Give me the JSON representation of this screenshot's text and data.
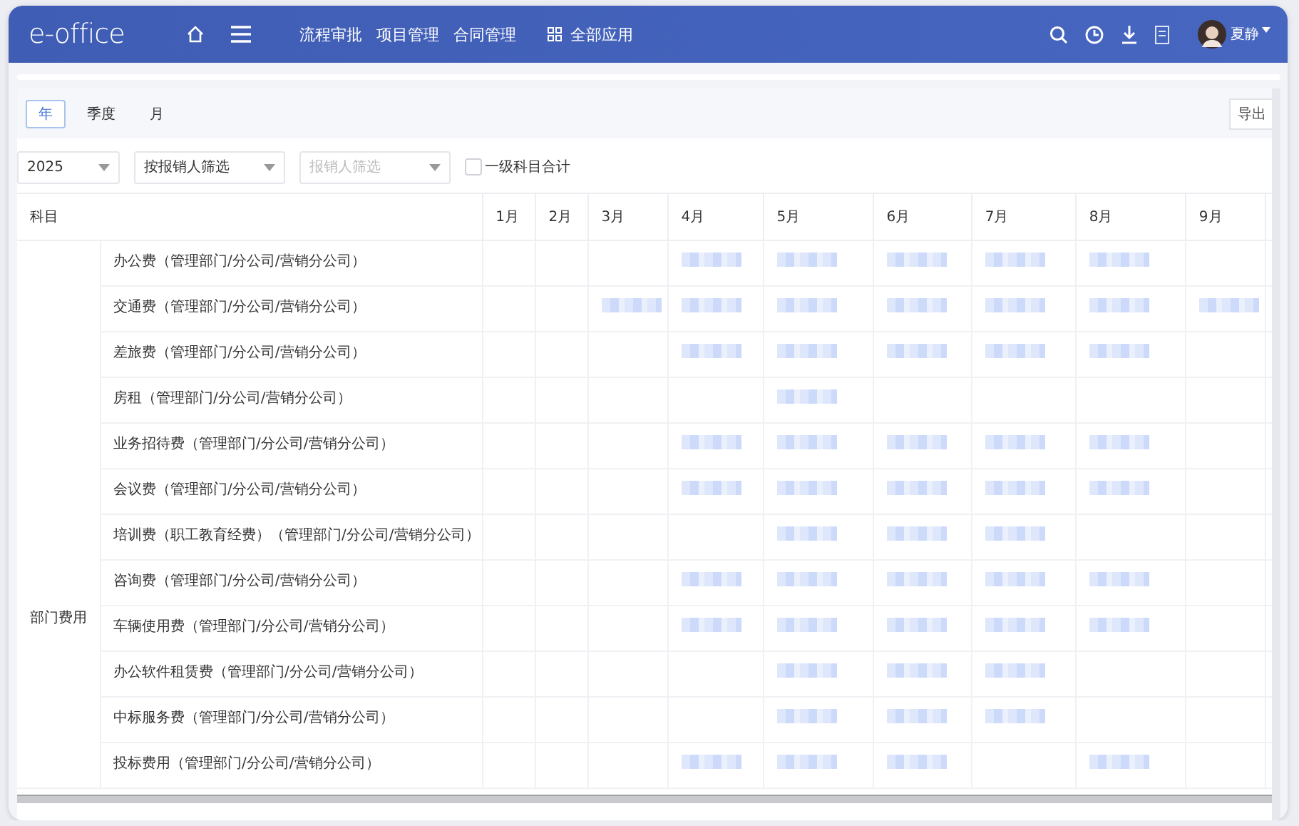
{
  "header": {
    "logo": "e-office",
    "nav": [
      "流程审批",
      "项目管理",
      "合同管理"
    ],
    "all_apps": "全部应用",
    "user": {
      "name": "夏静"
    }
  },
  "period_tabs": [
    {
      "label": "年",
      "selected": true
    },
    {
      "label": "季度",
      "selected": false
    },
    {
      "label": "月",
      "selected": false
    }
  ],
  "export_button": "导出",
  "filters": {
    "year": "2025",
    "filter_mode": "按报销人筛选",
    "reporter": {
      "placeholder": "报销人筛选"
    },
    "level_total": {
      "label": "一级科目合计",
      "checked": false
    }
  },
  "table": {
    "columns": [
      "科目",
      "1月",
      "2月",
      "3月",
      "4月",
      "5月",
      "6月",
      "7月",
      "8月",
      "9月"
    ],
    "groups": [
      {
        "name": "部门费用",
        "rows": [
          {
            "name": "办公费（管理部门/分公司/营销分公司）",
            "redacted": [
              false,
              false,
              false,
              true,
              true,
              true,
              true,
              true,
              false
            ]
          },
          {
            "name": "交通费（管理部门/分公司/营销分公司）",
            "redacted": [
              false,
              false,
              true,
              true,
              true,
              true,
              true,
              true,
              true
            ]
          },
          {
            "name": "差旅费（管理部门/分公司/营销分公司）",
            "redacted": [
              false,
              false,
              false,
              true,
              true,
              true,
              true,
              true,
              false
            ]
          },
          {
            "name": "房租（管理部门/分公司/营销分公司）",
            "redacted": [
              false,
              false,
              false,
              false,
              true,
              false,
              false,
              false,
              false
            ]
          },
          {
            "name": "业务招待费（管理部门/分公司/营销分公司）",
            "redacted": [
              false,
              false,
              false,
              true,
              true,
              true,
              true,
              true,
              false
            ]
          },
          {
            "name": "会议费（管理部门/分公司/营销分公司）",
            "redacted": [
              false,
              false,
              false,
              true,
              true,
              true,
              true,
              true,
              false
            ]
          },
          {
            "name": "培训费（职工教育经费）（管理部门/分公司/营销分公司）",
            "redacted": [
              false,
              false,
              false,
              false,
              true,
              true,
              true,
              false,
              false
            ]
          },
          {
            "name": "咨询费（管理部门/分公司/营销分公司）",
            "redacted": [
              false,
              false,
              false,
              true,
              true,
              true,
              true,
              true,
              false
            ]
          },
          {
            "name": "车辆使用费（管理部门/分公司/营销分公司）",
            "redacted": [
              false,
              false,
              false,
              true,
              true,
              true,
              true,
              true,
              false
            ]
          },
          {
            "name": "办公软件租赁费（管理部门/分公司/营销分公司）",
            "redacted": [
              false,
              false,
              false,
              false,
              true,
              true,
              true,
              false,
              false
            ]
          },
          {
            "name": "中标服务费（管理部门/分公司/营销分公司）",
            "redacted": [
              false,
              false,
              false,
              false,
              true,
              true,
              true,
              false,
              false
            ]
          },
          {
            "name": "投标费用（管理部门/分公司/营销分公司）",
            "redacted": [
              false,
              false,
              false,
              true,
              true,
              true,
              false,
              true,
              false
            ]
          }
        ]
      }
    ]
  }
}
